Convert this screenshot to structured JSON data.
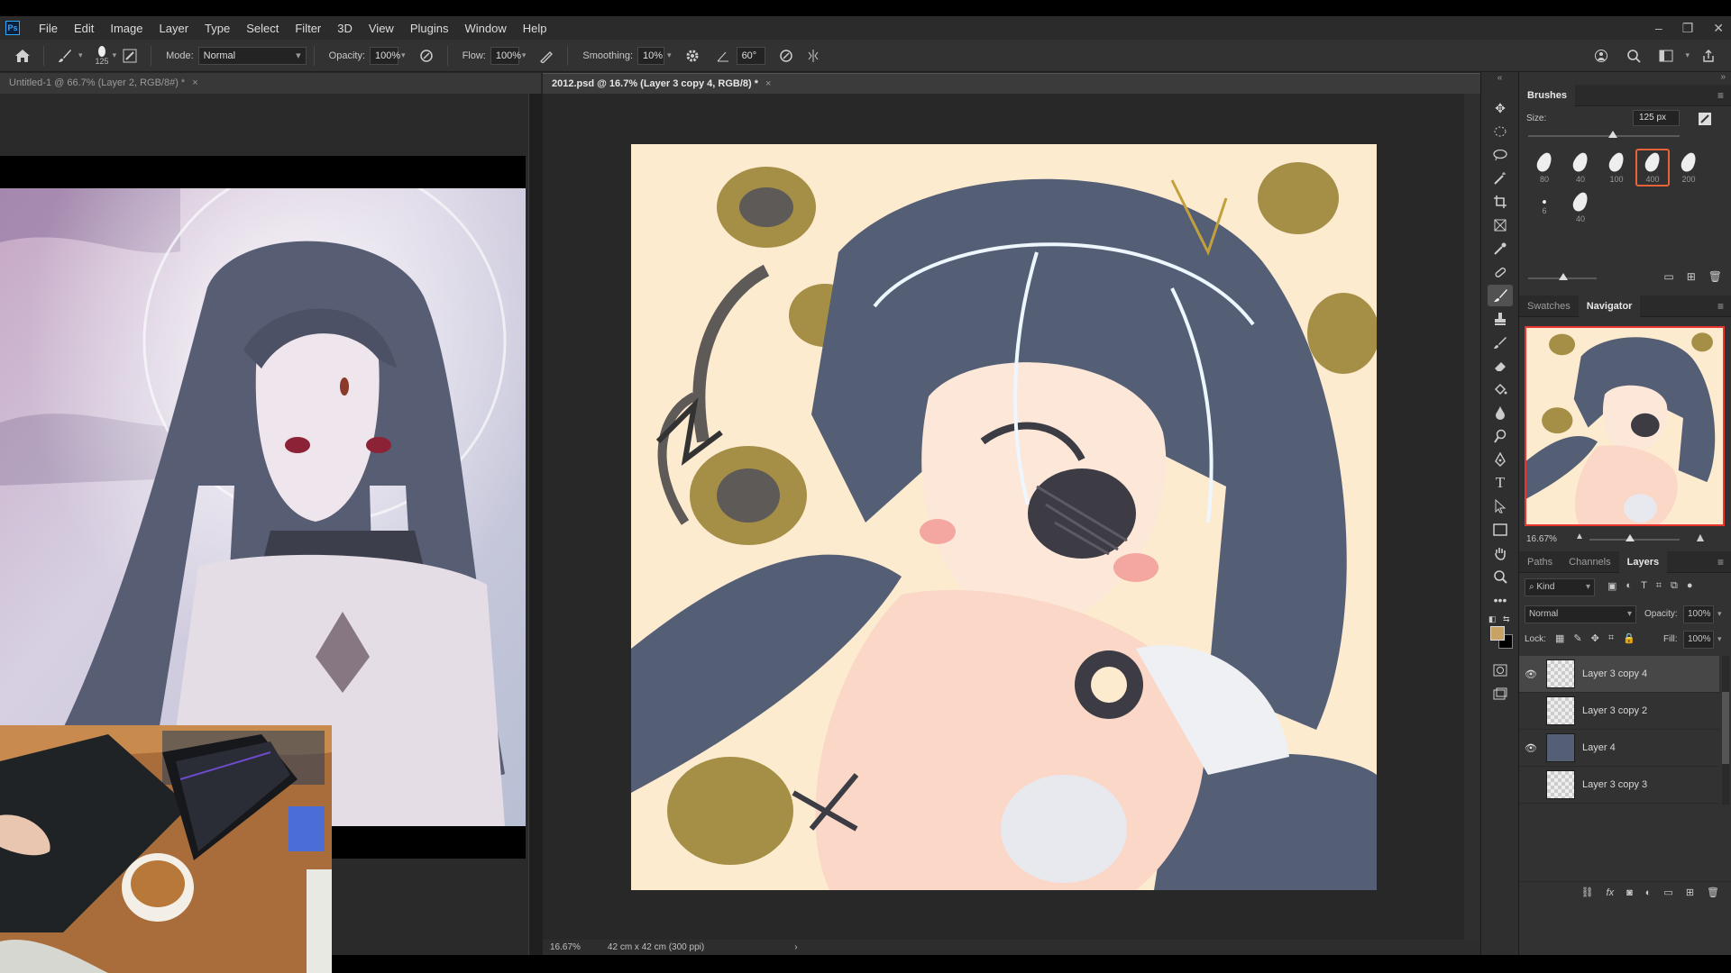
{
  "app": {
    "logo": "Ps"
  },
  "menu": [
    "File",
    "Edit",
    "Image",
    "Layer",
    "Type",
    "Select",
    "Filter",
    "3D",
    "View",
    "Plugins",
    "Window",
    "Help"
  ],
  "window_controls": {
    "minimize": "–",
    "restore": "❐",
    "close": "✕"
  },
  "options": {
    "brush_size": "125",
    "mode_label": "Mode:",
    "mode_value": "Normal",
    "opacity_label": "Opacity:",
    "opacity_value": "100%",
    "flow_label": "Flow:",
    "flow_value": "100%",
    "smoothing_label": "Smoothing:",
    "smoothing_value": "10%",
    "angle_value": "60°"
  },
  "tabs": [
    {
      "title": "Untitled-1 @ 66.7% (Layer 2, RGB/8#) *",
      "active": false
    },
    {
      "title": "2012.psd @ 16.7% (Layer 3 copy 4, RGB/8) *",
      "active": true
    }
  ],
  "tab_close": "×",
  "status": {
    "zoom": "16.67%",
    "doc_size": "42 cm x 42 cm (300 ppi)",
    "arrow": "›"
  },
  "brushes_panel": {
    "title": "Brushes",
    "size_label": "Size:",
    "size_value": "125 px",
    "size_level": 0.56,
    "presets": [
      {
        "size": "80",
        "selected": false
      },
      {
        "size": "40",
        "selected": false
      },
      {
        "size": "100",
        "selected": false
      },
      {
        "size": "400",
        "selected": true
      },
      {
        "size": "200",
        "selected": false
      },
      {
        "size": "6",
        "selected": false
      },
      {
        "size": "40",
        "selected": false
      }
    ]
  },
  "navigator_panel": {
    "tabs": [
      "Swatches",
      "Navigator"
    ],
    "active_tab": "Navigator",
    "zoom": "16.67%"
  },
  "layers_panel": {
    "tabs": [
      "Paths",
      "Channels",
      "Layers"
    ],
    "active_tab": "Layers",
    "filter_label": "Kind",
    "blend_mode": "Normal",
    "opacity_label": "Opacity:",
    "opacity_value": "100%",
    "lock_label": "Lock:",
    "fill_label": "Fill:",
    "fill_value": "100%",
    "layers": [
      {
        "name": "Layer 3 copy 4",
        "visible": true,
        "selected": true
      },
      {
        "name": "Layer 3 copy 2",
        "visible": false,
        "selected": false
      },
      {
        "name": "Layer 4",
        "visible": true,
        "selected": false
      },
      {
        "name": "Layer 3 copy 3",
        "visible": false,
        "selected": false
      }
    ]
  },
  "colors": {
    "foreground": "#c8a265",
    "background": "#000000",
    "accent": "#e8623a",
    "canvas_bg": "#fdebd0"
  }
}
